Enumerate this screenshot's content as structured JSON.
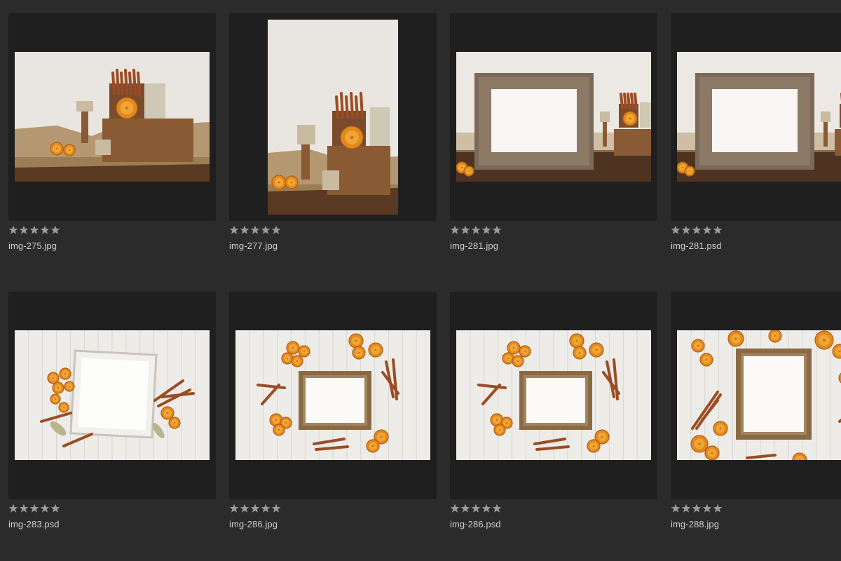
{
  "grid": {
    "items": [
      {
        "filename": "img-275.jpg",
        "rating": 0,
        "rating_max": 5,
        "scene": "still-life-landscape"
      },
      {
        "filename": "img-277.jpg",
        "rating": 0,
        "rating_max": 5,
        "scene": "still-life-portrait"
      },
      {
        "filename": "img-281.jpg",
        "rating": 0,
        "rating_max": 5,
        "scene": "frame-on-table"
      },
      {
        "filename": "img-281.psd",
        "rating": 0,
        "rating_max": 5,
        "scene": "frame-on-table"
      },
      {
        "filename": "img-283.psd",
        "rating": 0,
        "rating_max": 5,
        "scene": "white-frame-flatlay"
      },
      {
        "filename": "img-286.jpg",
        "rating": 0,
        "rating_max": 5,
        "scene": "wood-frame-flatlay"
      },
      {
        "filename": "img-286.psd",
        "rating": 0,
        "rating_max": 5,
        "scene": "wood-frame-flatlay"
      },
      {
        "filename": "img-288.jpg",
        "rating": 0,
        "rating_max": 5,
        "scene": "portrait-frame-flatlay"
      }
    ]
  },
  "colors": {
    "background": "#2b2b2b",
    "cell": "#1f1f1f",
    "star": "#9a9a9a",
    "filename_text": "#cfcfcf"
  }
}
